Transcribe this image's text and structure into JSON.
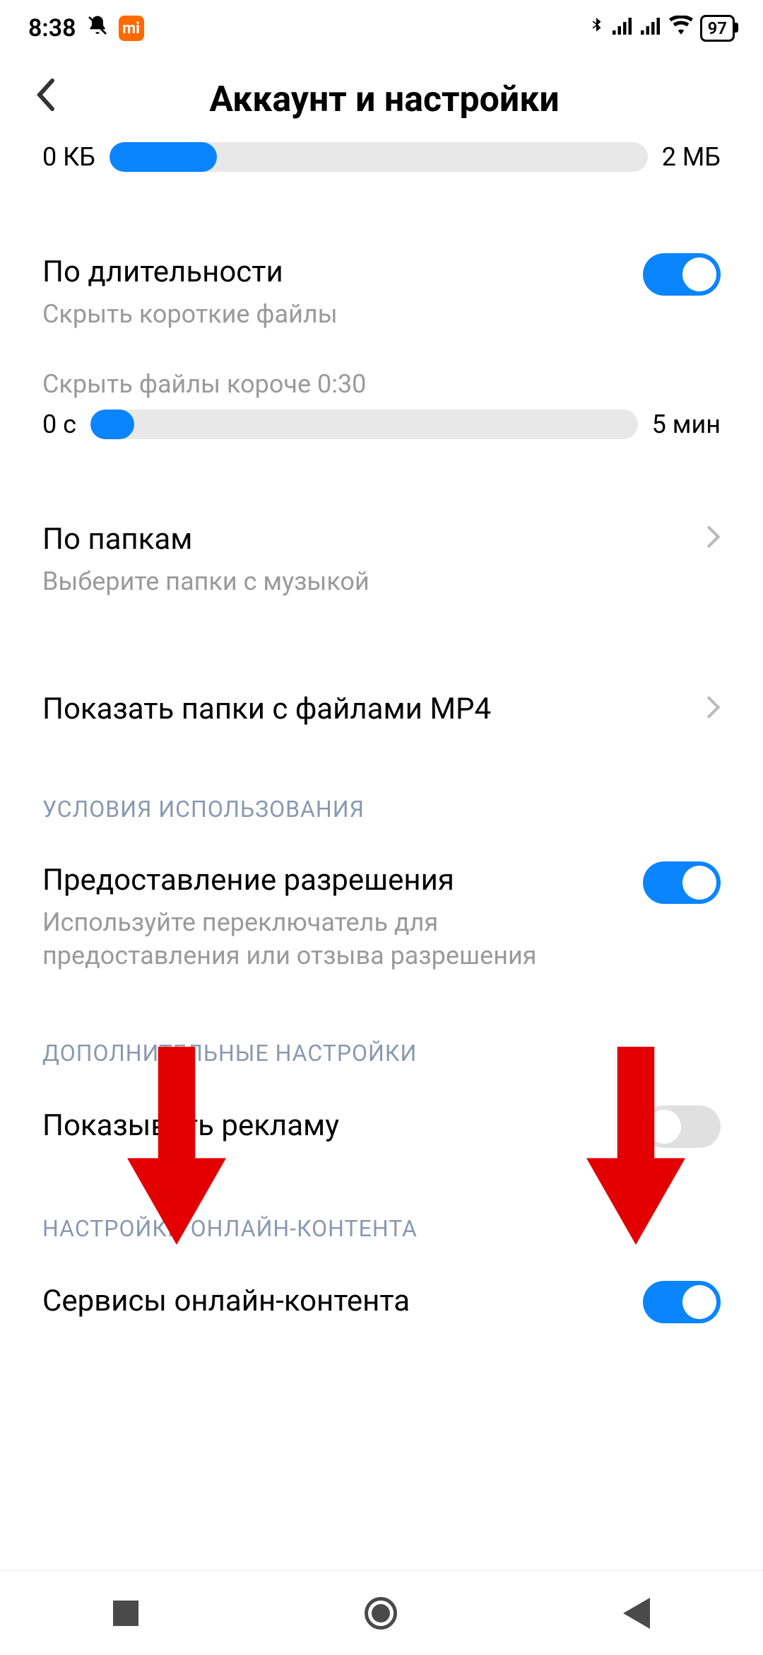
{
  "status": {
    "time": "8:38",
    "battery": "97"
  },
  "header": {
    "title": "Аккаунт и настройки"
  },
  "size_filter": {
    "min_label": "0 КБ",
    "max_label": "2 МБ"
  },
  "duration": {
    "title": "По длительности",
    "subtitle": "Скрыть короткие файлы",
    "hint": "Скрыть файлы короче 0:30",
    "min_label": "0 с",
    "max_label": "5 мин"
  },
  "folders": {
    "title": "По папкам",
    "subtitle": "Выберите папки с музыкой"
  },
  "mp4": {
    "title": "Показать папки с файлами MP4"
  },
  "sections": {
    "terms": "УСЛОВИЯ ИСПОЛЬЗОВАНИЯ",
    "additional": "ДОПОЛНИТЕЛЬНЫЕ НАСТРОЙКИ",
    "online": "НАСТРОЙКИ ОНЛАЙН-КОНТЕНТА"
  },
  "permission": {
    "title": "Предоставление разрешения",
    "subtitle": "Используйте переключатель для предоставления или отзыва разрешения"
  },
  "ads": {
    "title": "Показывать рекламу"
  },
  "online_services": {
    "title": "Сервисы онлайн-контента"
  }
}
